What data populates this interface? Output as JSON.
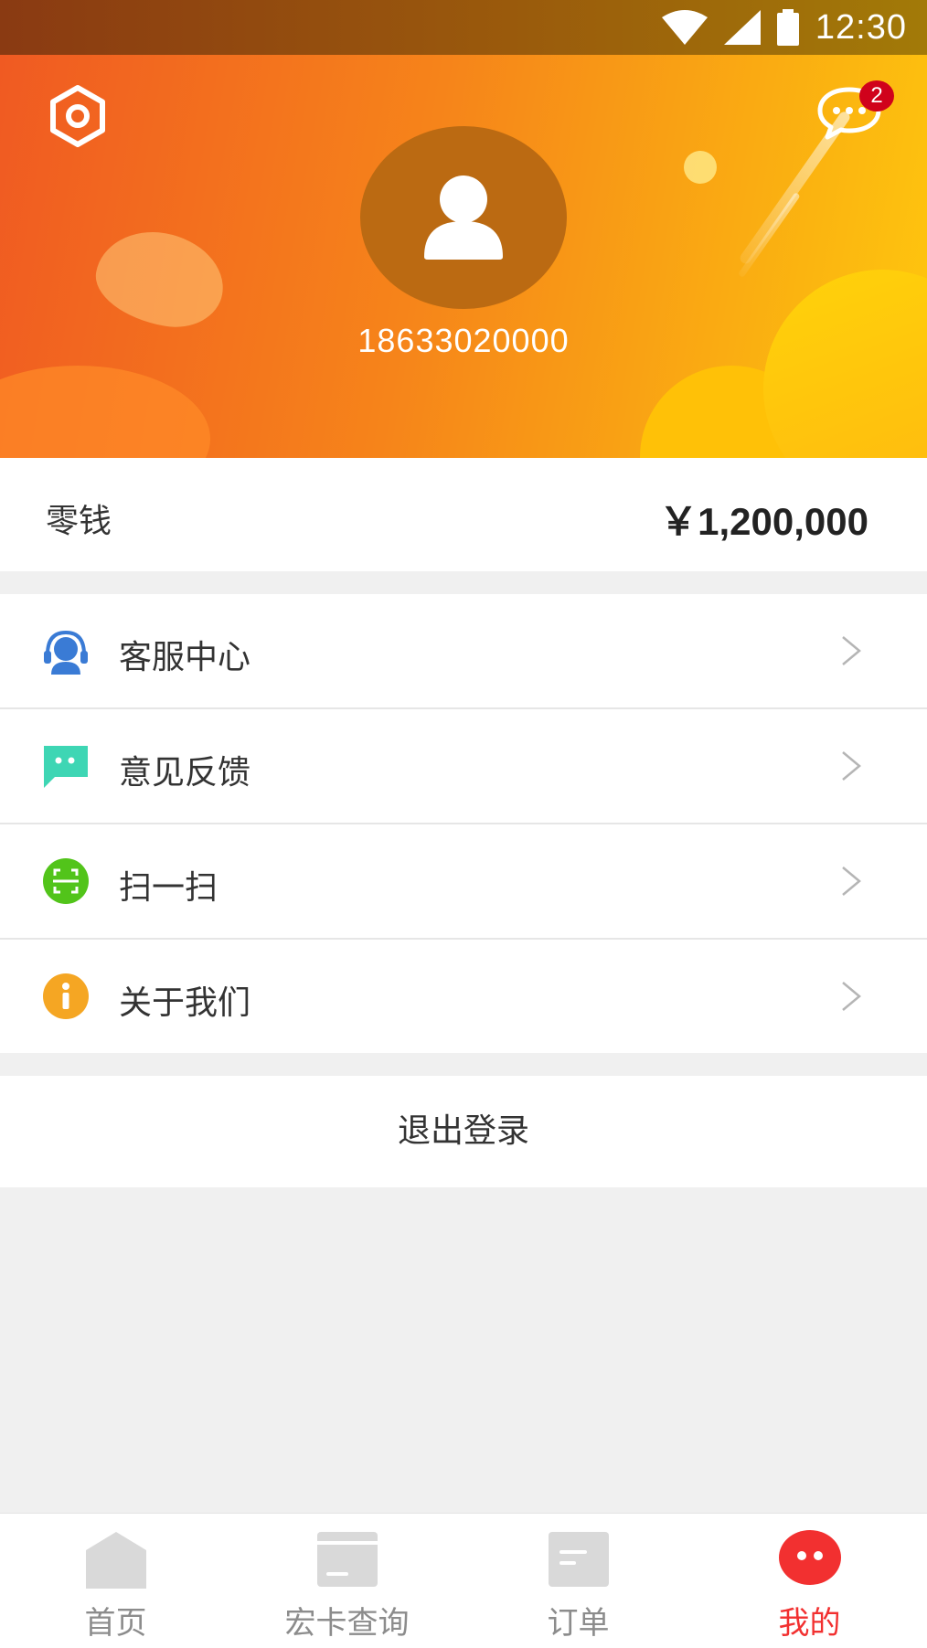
{
  "status_bar": {
    "time": "12:30"
  },
  "header": {
    "phone": "18633020000",
    "message_badge": "2",
    "colors": {
      "gradient_start": "#f05a22",
      "gradient_end": "#ffc70e"
    }
  },
  "wallet": {
    "label": "零钱",
    "amount": "￥1,200,000"
  },
  "menu": [
    {
      "label": "客服中心",
      "icon": "headset-icon",
      "color": "#3a7bd5"
    },
    {
      "label": "意见反馈",
      "icon": "feedback-icon",
      "color": "#3ed6b4"
    },
    {
      "label": "扫一扫",
      "icon": "scan-icon",
      "color": "#52c41a"
    },
    {
      "label": "关于我们",
      "icon": "info-icon",
      "color": "#f5a623"
    }
  ],
  "logout": {
    "label": "退出登录"
  },
  "tabbar": {
    "active_color": "#f23030",
    "items": [
      {
        "label": "首页",
        "icon": "home-icon"
      },
      {
        "label": "宏卡查询",
        "icon": "card-icon"
      },
      {
        "label": "订单",
        "icon": "order-icon"
      },
      {
        "label": "我的",
        "icon": "profile-icon",
        "active": true
      }
    ]
  }
}
